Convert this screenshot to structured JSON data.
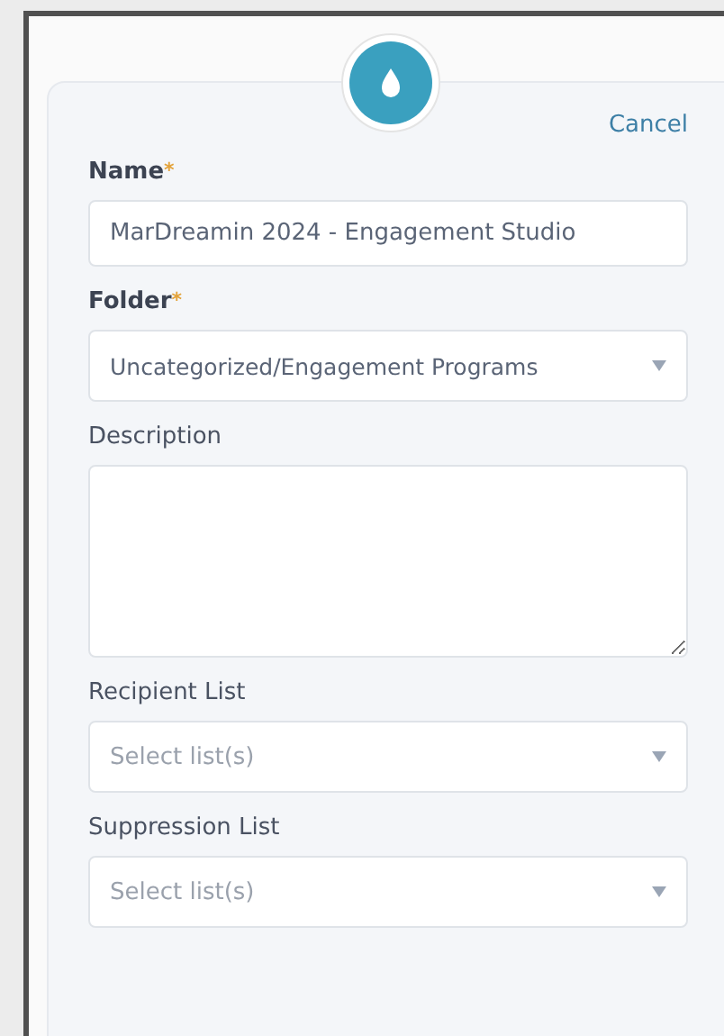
{
  "dialog": {
    "cancel": "Cancel",
    "fields": [
      {
        "kind": "text",
        "label": "Name",
        "required": true,
        "required_mark": "*",
        "value": "MarDreamin 2024 - Engagement Studio"
      },
      {
        "kind": "select",
        "label": "Folder",
        "required": true,
        "required_mark": "*",
        "value": "Uncategorized/Engagement Programs"
      },
      {
        "kind": "textarea",
        "label": "Description",
        "required": false
      },
      {
        "kind": "select",
        "label": "Recipient List",
        "required": false,
        "placeholder": "Select list(s)"
      },
      {
        "kind": "select",
        "label": "Suppression List",
        "required": false,
        "placeholder": "Select list(s)"
      }
    ]
  }
}
